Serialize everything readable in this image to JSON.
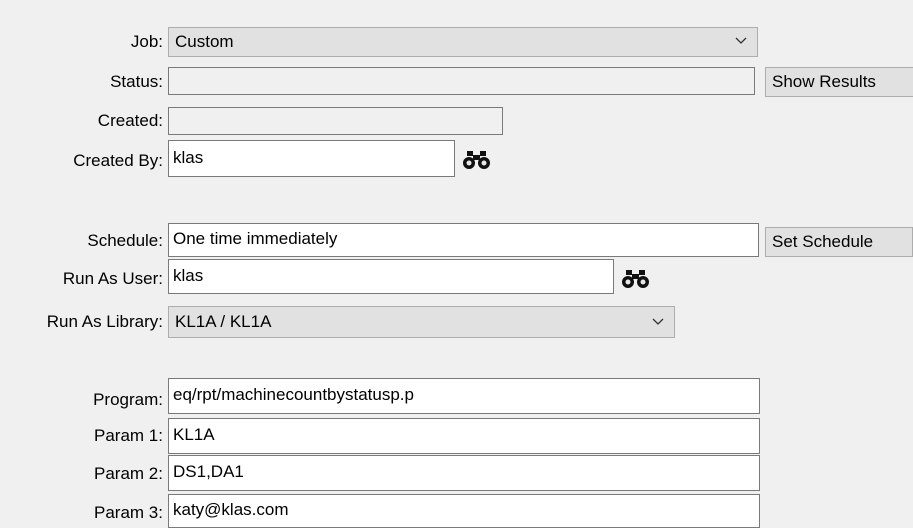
{
  "form": {
    "job": {
      "label": "Job:",
      "value": "Custom"
    },
    "status": {
      "label": "Status:",
      "value": ""
    },
    "show_results_label": "Show Results",
    "created": {
      "label": "Created:",
      "value": ""
    },
    "created_by": {
      "label": "Created By:",
      "value": "klas"
    },
    "schedule": {
      "label": "Schedule:",
      "value": "One time immediately"
    },
    "set_schedule_label": "Set Schedule",
    "run_as_user": {
      "label": "Run As User:",
      "value": "klas"
    },
    "run_as_library": {
      "label": "Run As Library:",
      "value": "KL1A / KL1A"
    },
    "program": {
      "label": "Program:",
      "value": "eq/rpt/machinecountbystatusp.p"
    },
    "param1": {
      "label": "Param 1:",
      "value": "KL1A"
    },
    "param2": {
      "label": "Param 2:",
      "value": "DS1,DA1"
    },
    "param3": {
      "label": "Param 3:",
      "value": "katy@klas.com"
    }
  },
  "icons": {
    "lookup": "binoculars-icon",
    "dropdown": "chevron-down-icon"
  }
}
